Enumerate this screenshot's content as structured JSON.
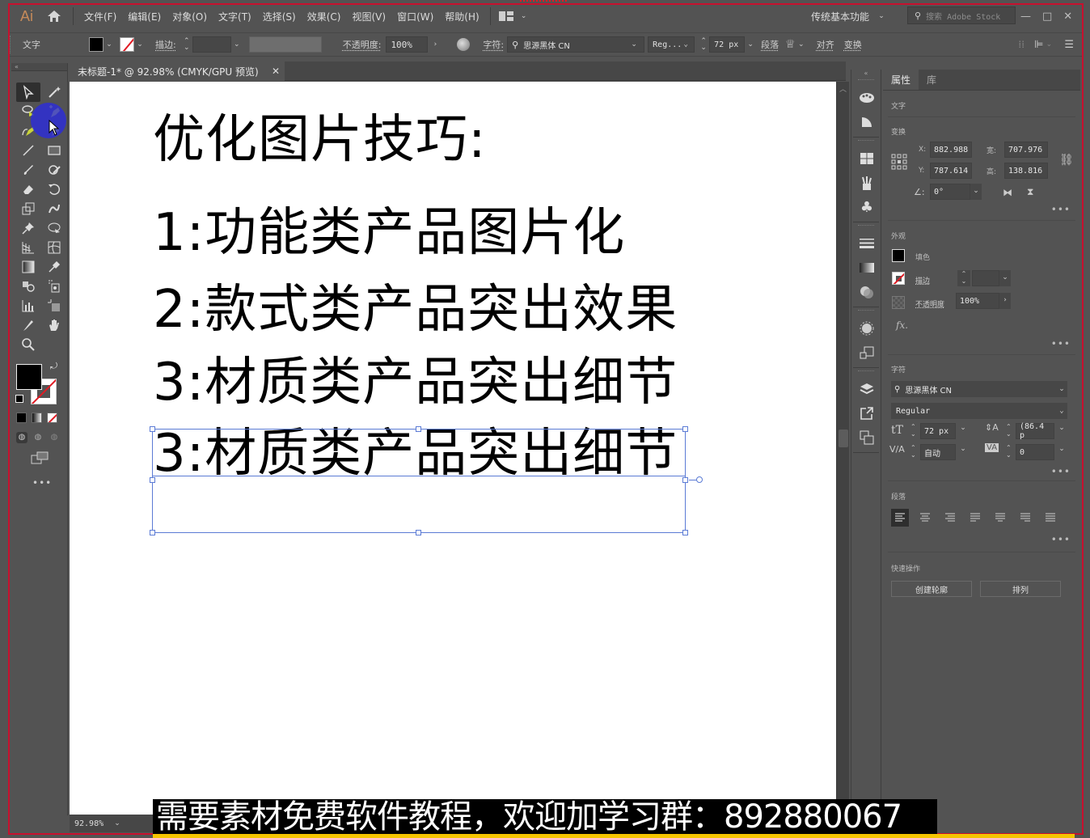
{
  "app": {
    "logo": "Ai",
    "menu": [
      "文件(F)",
      "编辑(E)",
      "对象(O)",
      "文字(T)",
      "选择(S)",
      "效果(C)",
      "视图(V)",
      "窗口(W)",
      "帮助(H)"
    ],
    "workspace": "传统基本功能",
    "stock_search_placeholder": "搜索 Adobe Stock",
    "window_controls": [
      "—",
      "□",
      "✕"
    ]
  },
  "control_bar": {
    "type_label": "文字",
    "stroke_label": "描边:",
    "opacity_label": "不透明度:",
    "opacity_value": "100%",
    "character_label": "字符:",
    "font_family": "思源黑体 CN",
    "font_style": "Reg...",
    "font_size": "72 px",
    "paragraph_label": "段落",
    "align_label": "对齐",
    "transform_label": "变换"
  },
  "document": {
    "tab_title": "未标题-1* @ 92.98% (CMYK/GPU 预览)",
    "zoom": "92.98%"
  },
  "artboard": {
    "lines": [
      "优化图片技巧:",
      "1:功能类产品图片化",
      "2:款式类产品突出效果",
      "3:材质类产品突出细节",
      "3:材质类产品突出细节"
    ]
  },
  "properties_panel": {
    "tabs": [
      "属性",
      "库"
    ],
    "section_type": "文字",
    "transform": {
      "title": "变换",
      "x_label": "X:",
      "x": "882.988",
      "y_label": "Y:",
      "y": "787.614",
      "w_label": "宽:",
      "w": "707.976",
      "h_label": "高:",
      "h": "138.816",
      "angle": "0°"
    },
    "appearance": {
      "title": "外观",
      "fill_label": "填色",
      "stroke_label": "描边",
      "opacity_label": "不透明度",
      "opacity": "100%",
      "fx_label": "fx."
    },
    "character": {
      "title": "字符",
      "font_family": "思源黑体 CN",
      "font_style": "Regular",
      "font_size": "72 px",
      "leading": "(86.4 p",
      "kerning": "自动",
      "tracking": "0"
    },
    "paragraph": {
      "title": "段落"
    },
    "quick_actions": {
      "title": "快速操作",
      "create_outlines": "创建轮廓",
      "arrange": "排列"
    }
  },
  "caption": "需要素材免费软件教程，欢迎加学习群：892880067",
  "colors": {
    "ui_bg": "#535353",
    "selection": "#5b7bd5",
    "frame_red": "#c8102e",
    "caption_bar": "#f5c400"
  }
}
